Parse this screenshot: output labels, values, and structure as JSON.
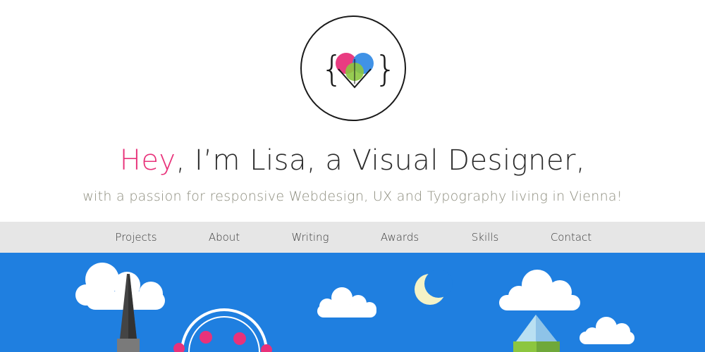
{
  "logo": {
    "brace_left": "{",
    "brace_right": "}",
    "colors": {
      "pink": "#e8327a",
      "blue": "#2b86e3",
      "green": "#8cc63f",
      "outline": "#1a1a1a"
    }
  },
  "headline": {
    "greeting": "Hey",
    "rest": ", I’m Lisa, a Visual Designer,"
  },
  "subline": "with a passion for responsive Webdesign, UX and Typography living in Vienna!",
  "nav": {
    "items": [
      {
        "label": "Projects"
      },
      {
        "label": "About"
      },
      {
        "label": "Writing"
      },
      {
        "label": "Awards"
      },
      {
        "label": "Skills"
      },
      {
        "label": "Contact"
      }
    ]
  },
  "scene": {
    "sky_color": "#1f7fe0",
    "cloud_color": "#ffffff",
    "moon_color": "#f4f2c6",
    "ferris_wheel_pod_color": "#e8327a",
    "mountain_colors": [
      "#b9e0f2",
      "#8ec3e8",
      "#8cc63f",
      "#6fa83a"
    ],
    "spire_color": "#444444"
  }
}
